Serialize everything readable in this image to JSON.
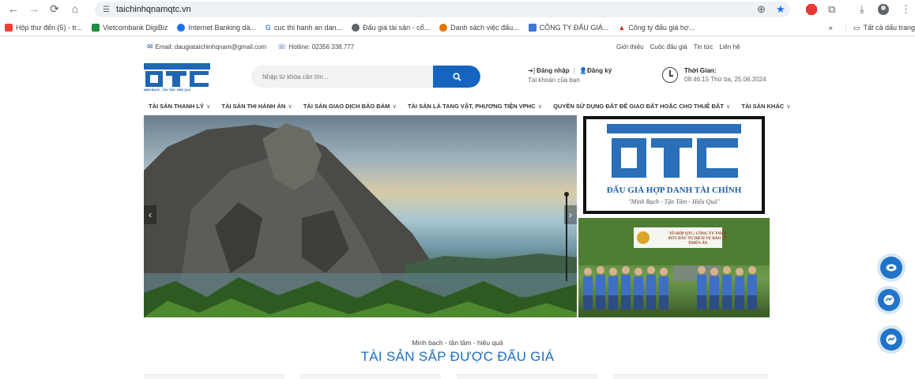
{
  "browser": {
    "url": "taichinhqnamqtc.vn",
    "bookmarks": [
      {
        "label": "Hộp thư đến (5) - tr...",
        "color": "#ea4335"
      },
      {
        "label": "Vietcombank DigiBiz",
        "color": "#1e8e3e"
      },
      {
        "label": "Internet Banking dà...",
        "color": "#1a73e8"
      },
      {
        "label": "cuc thi hanh an dan...",
        "color": "#4285f4"
      },
      {
        "label": "Đấu giá tài sản - cổ...",
        "color": "#5f6368"
      },
      {
        "label": "Danh sách việc đấu...",
        "color": "#e37400"
      },
      {
        "label": "CÔNG TY ĐẤU GIÁ...",
        "color": "#3c78d8"
      },
      {
        "label": "Công ty đấu giá hợ...",
        "color": "#d93025"
      }
    ],
    "bookmarks_more": "»",
    "all_bookmarks": "Tất cả dấu trang"
  },
  "topbar": {
    "email": "Email: daugiataichinhqnam@gmail.com",
    "hotline": "Hotline: 02356 338.777",
    "links": [
      "Giới thiệu",
      "Cuộc đấu giá",
      "Tin tức",
      "Liên hệ"
    ]
  },
  "header": {
    "logo_text": "MINH BẠCH - TẬN TÂM - HIỆU QUẢ",
    "search_placeholder": "Nhập từ khóa cần tìm...",
    "login": "Đăng nhập",
    "register": "Đăng ký",
    "account_sub": "Tài khoản của bạn",
    "time_label": "Thời Gian:",
    "time_value": "08:46:15 Thứ ba, 25.06.2024"
  },
  "menu": [
    "TÀI SẢN THANH LÝ",
    "TÀI SẢN THI HÀNH ÁN",
    "TÀI SẢN GIAO DỊCH BẢO ĐẢM",
    "TÀI SẢN LÀ TANG VẬT, PHƯƠNG TIỆN VPHC",
    "QUYỀN SỬ DỤNG ĐẤT ĐỂ GIAO ĐẤT HOẶC CHO THUÊ ĐẤT",
    "TÀI SẢN KHÁC"
  ],
  "banner1": {
    "brand": "ĐẤU GIÁ HỢP DANH TÀI CHÍNH",
    "slogan": "\"Minh Bạch - Tận Tâm - Hiệu Quả\""
  },
  "banner2": {
    "caption_lines": [
      "TỔ HỢP QTC: CÔNG TY TNHH",
      "MTV ĐẦU TƯ DỊCH VỤ BẢO VỆ",
      "THIÊN ÂN"
    ]
  },
  "section": {
    "tagline": "Minh bạch - tận tâm - hiệu quả",
    "title": "TÀI SẢN SẮP ĐƯỢC ĐẤU GIÁ"
  },
  "colors": {
    "brand_blue": "#1565c0",
    "title_blue": "#1f6fc1"
  }
}
